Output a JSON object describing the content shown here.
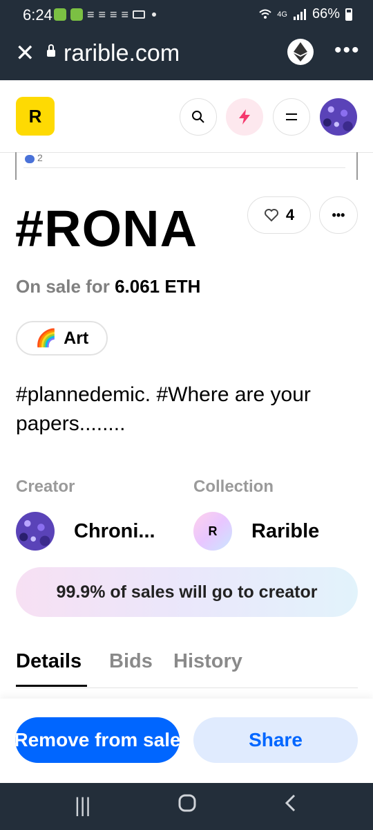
{
  "status_bar": {
    "time": "6:24",
    "network": "4G",
    "battery": "66%"
  },
  "browser": {
    "url": "rarible.com"
  },
  "header": {
    "logo_letter": "R"
  },
  "partial_card": {
    "count": "2"
  },
  "item": {
    "title": "#RONA",
    "likes": "4",
    "on_sale_label": "On sale for",
    "price": "6.061 ETH",
    "tag_emoji": "🌈",
    "tag_label": "Art",
    "description": "#plannedemic.  #Where are your papers........"
  },
  "creator": {
    "label": "Creator",
    "name": "Chroni..."
  },
  "collection": {
    "label": "Collection",
    "name": "Rarible",
    "badge": "R"
  },
  "royalty_text": "99.9% of sales will go to creator",
  "tabs": [
    {
      "label": "Details"
    },
    {
      "label": "Bids"
    },
    {
      "label": "History"
    }
  ],
  "actions": {
    "remove_label": "Remove from sale",
    "share_label": "Share"
  },
  "colors": {
    "brand_yellow": "#feda03",
    "primary_blue": "#0066ff",
    "bolt_pink": "#f5386d",
    "system_bar": "#232e3a"
  }
}
